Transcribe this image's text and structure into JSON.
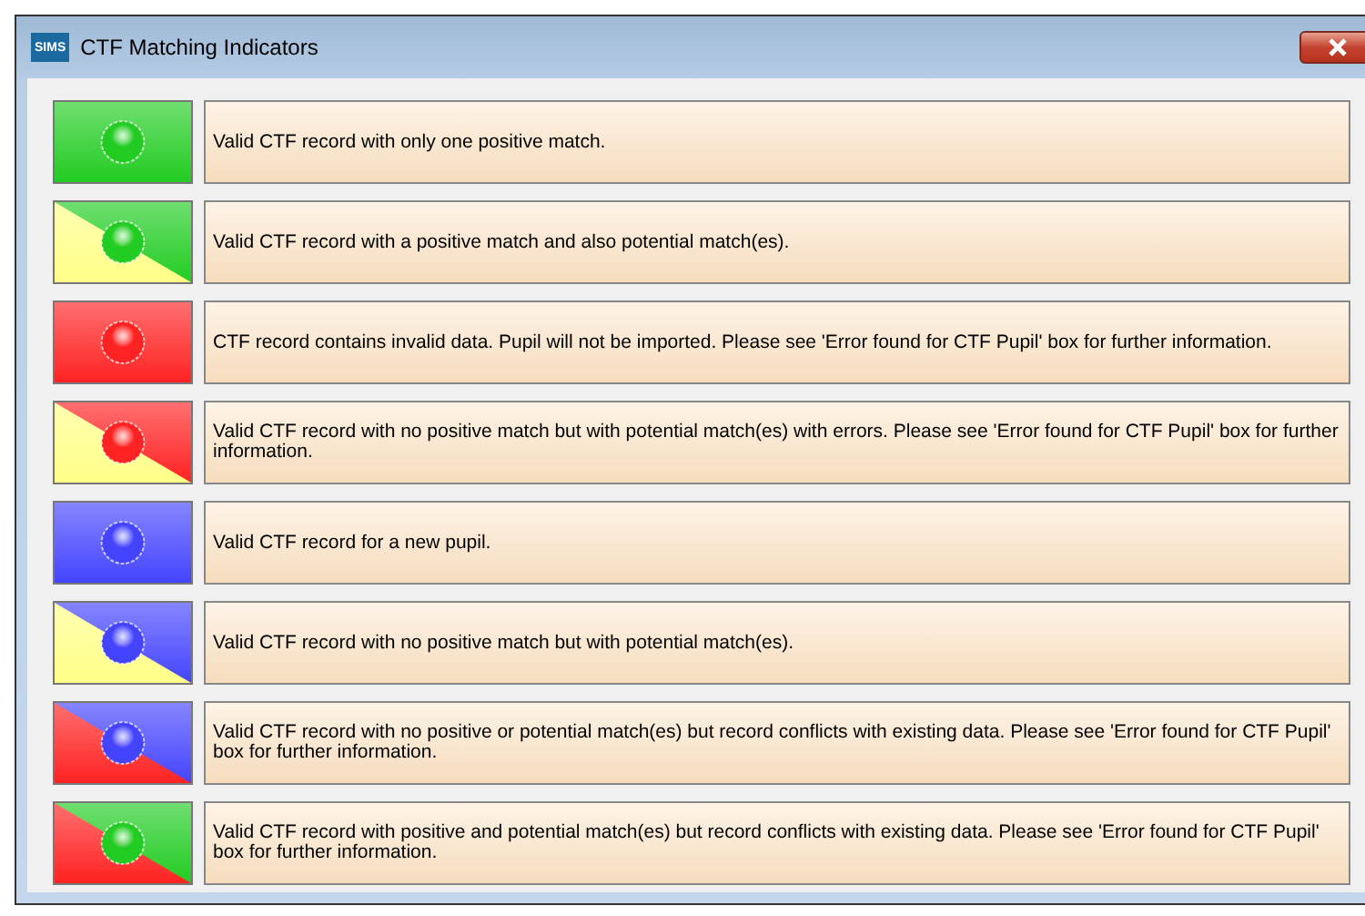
{
  "window": {
    "title": "CTF Matching Indicators",
    "icon": "SIMS"
  },
  "indicators": [
    {
      "color": "#22cc22",
      "text": "Valid CTF record with only one positive match."
    },
    {
      "color": "#22cc22",
      "corner": {
        "color": "#ffff88"
      },
      "text": "Valid CTF record with a positive match and also potential match(es)."
    },
    {
      "color": "#ff2222",
      "text": "CTF record contains invalid data. Pupil will not be imported. Please see 'Error found for CTF Pupil' box for further information."
    },
    {
      "color": "#ff2222",
      "corner": {
        "color": "#ffff88"
      },
      "text": "Valid CTF record with no positive match but with potential match(es) with errors. Please see 'Error found for CTF Pupil' box for further information."
    },
    {
      "color": "#4444ff",
      "text": "Valid CTF record for a new pupil."
    },
    {
      "color": "#4444ff",
      "corner": {
        "color": "#ffff88"
      },
      "text": "Valid CTF record with no positive match but with potential match(es)."
    },
    {
      "color": "#4444ff",
      "corner": {
        "color": "#ff2222"
      },
      "text": "Valid CTF record with no positive or potential match(es) but record conflicts with existing data. Please see 'Error found for CTF Pupil' box for further information."
    },
    {
      "color": "#22cc22",
      "corner": {
        "color": "#ff2222"
      },
      "text": "Valid CTF record with positive and potential match(es) but record conflicts with existing data. Please see 'Error found for CTF Pupil' box for further information."
    }
  ]
}
